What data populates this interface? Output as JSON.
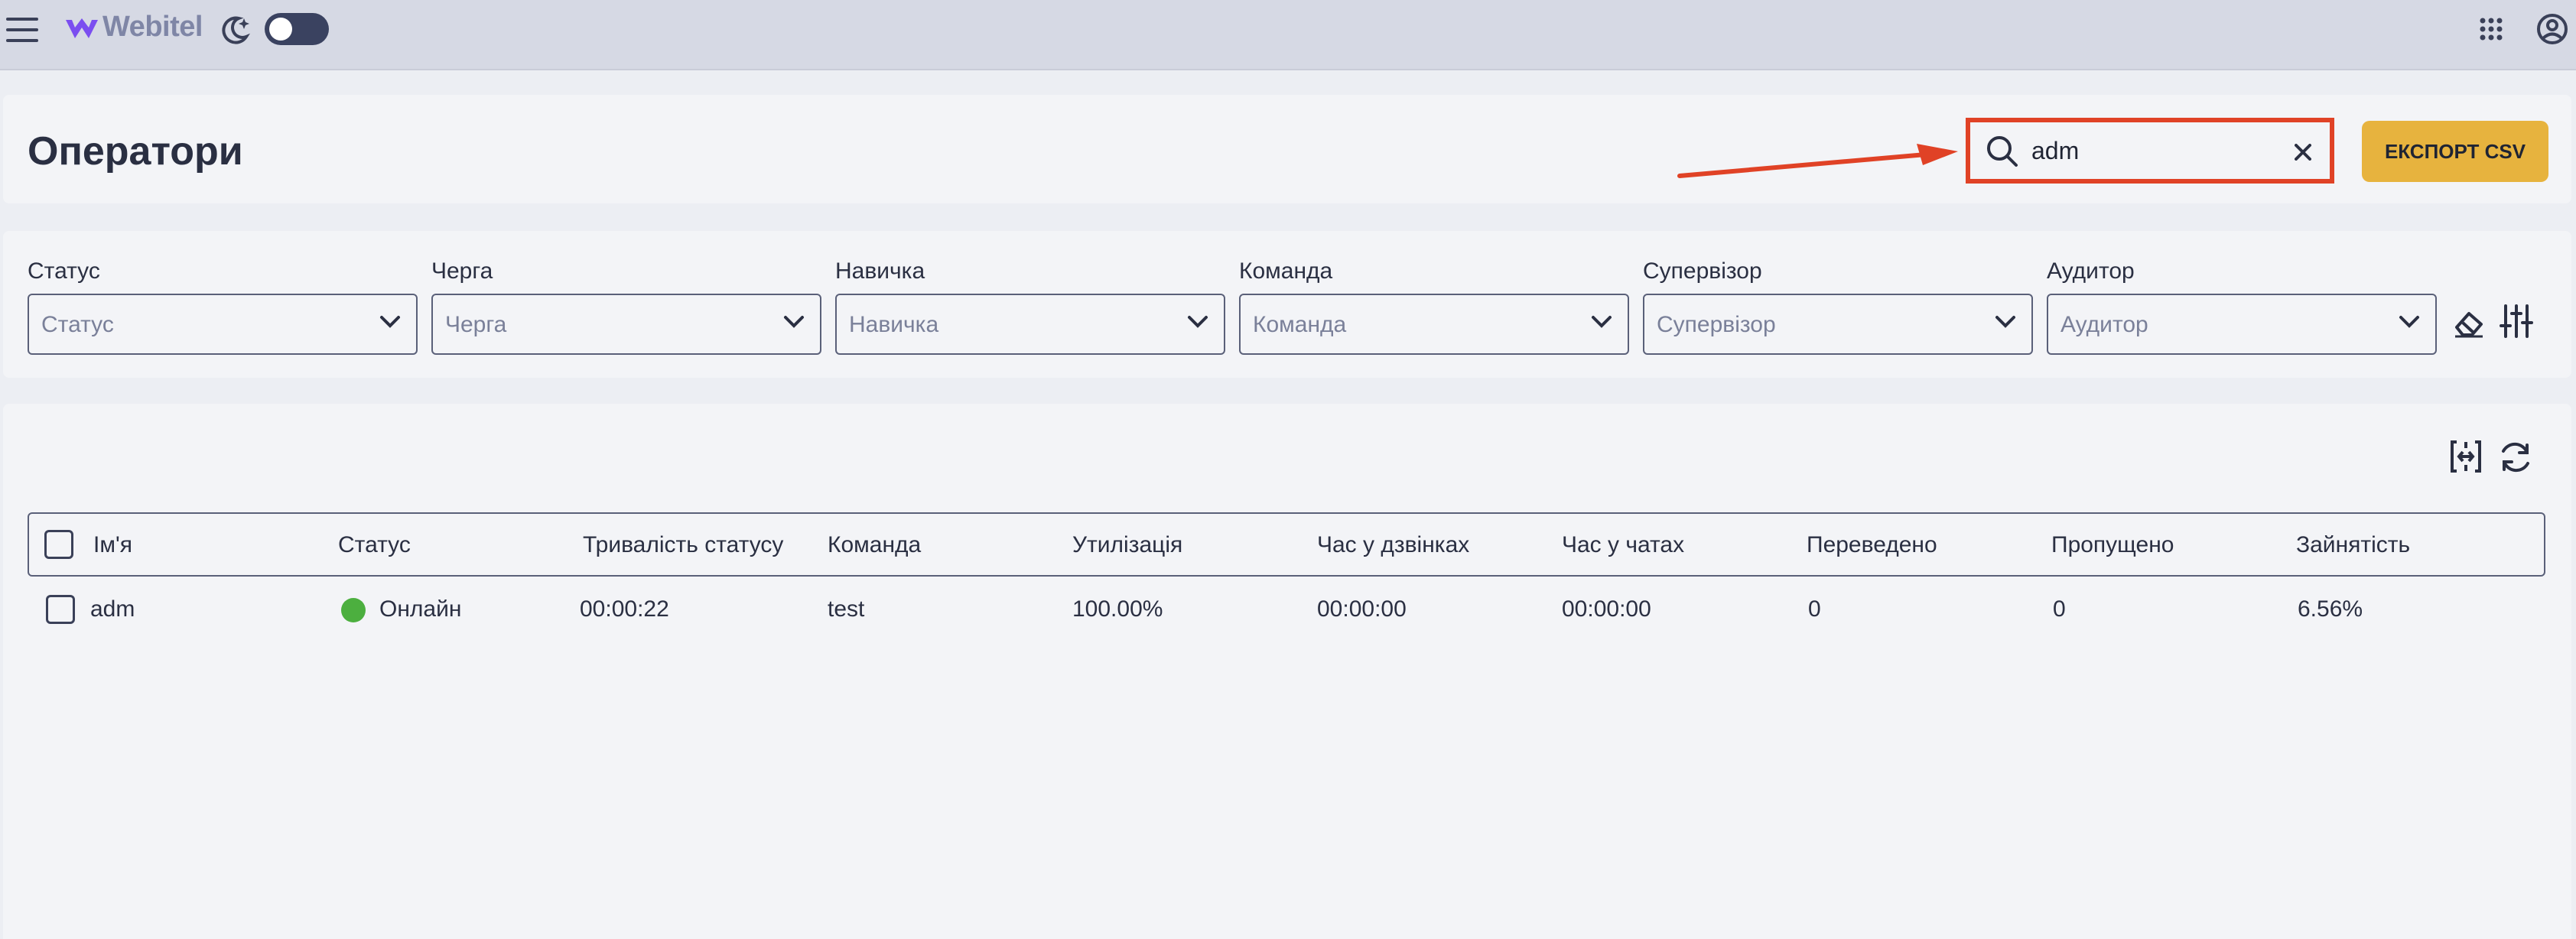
{
  "appbar": {
    "logo_text": "Webitel",
    "icons": [
      "hamburger-menu-icon",
      "webitel-logo-icon",
      "dark-mode-icon",
      "apps-grid-icon",
      "account-icon"
    ]
  },
  "header": {
    "title": "Оператори",
    "search": {
      "value": "adm"
    },
    "export_label": "ЕКСПОРТ CSV"
  },
  "filters": [
    {
      "label": "Статус",
      "placeholder": "Статус"
    },
    {
      "label": "Черга",
      "placeholder": "Черга"
    },
    {
      "label": "Навичка",
      "placeholder": "Навичка"
    },
    {
      "label": "Команда",
      "placeholder": "Команда"
    },
    {
      "label": "Супервізор",
      "placeholder": "Супервізор"
    },
    {
      "label": "Аудитор",
      "placeholder": "Аудитор"
    }
  ],
  "table": {
    "columns": [
      "Ім'я",
      "Статус",
      "Тривалість статусу",
      "Команда",
      "Утилізація",
      "Час у дзвінках",
      "Час у чатах",
      "Переведено",
      "Пропущено",
      "Зайнятість"
    ],
    "rows": [
      {
        "name": "adm",
        "status": "Онлайн",
        "status_duration": "00:00:22",
        "team": "test",
        "utilization": "100.00%",
        "call_time": "00:00:00",
        "chat_time": "00:00:00",
        "transferred": "0",
        "missed": "0",
        "occupancy": "6.56%"
      }
    ]
  },
  "colors": {
    "accent": "#e7b33e",
    "highlight": "#e04226",
    "online": "#4caf3f",
    "appbar": "#d6d9e4"
  }
}
